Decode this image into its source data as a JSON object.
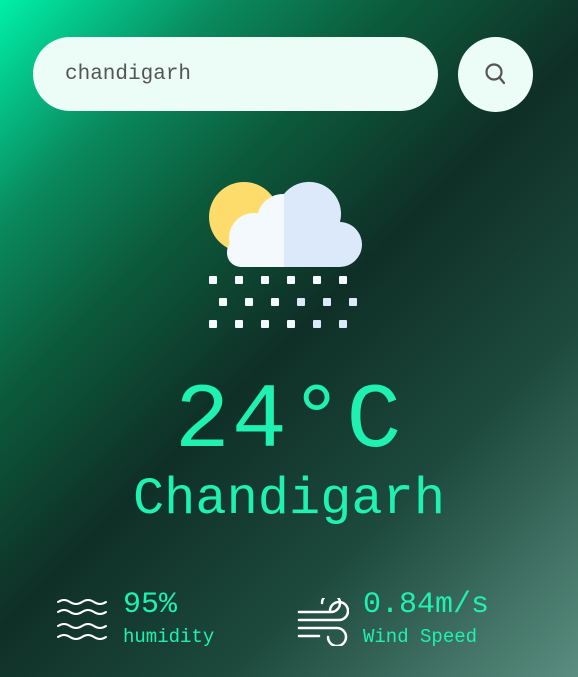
{
  "search": {
    "value": "chandigarh"
  },
  "weather": {
    "icon": "cloud-snow-sun-icon",
    "temperature": "24°C",
    "city": "Chandigarh"
  },
  "stats": {
    "humidity": {
      "icon": "humidity-waves-icon",
      "value": "95%",
      "label": "humidity"
    },
    "wind": {
      "icon": "wind-icon",
      "value": "0.84m/s",
      "label": "Wind Speed"
    }
  },
  "colors": {
    "accent": "#1ff1b0",
    "input_bg": "#ecfdf8",
    "gradient_start": "#00f0a8",
    "gradient_mid": "#0f2f26",
    "gradient_end": "#5b8e80"
  }
}
